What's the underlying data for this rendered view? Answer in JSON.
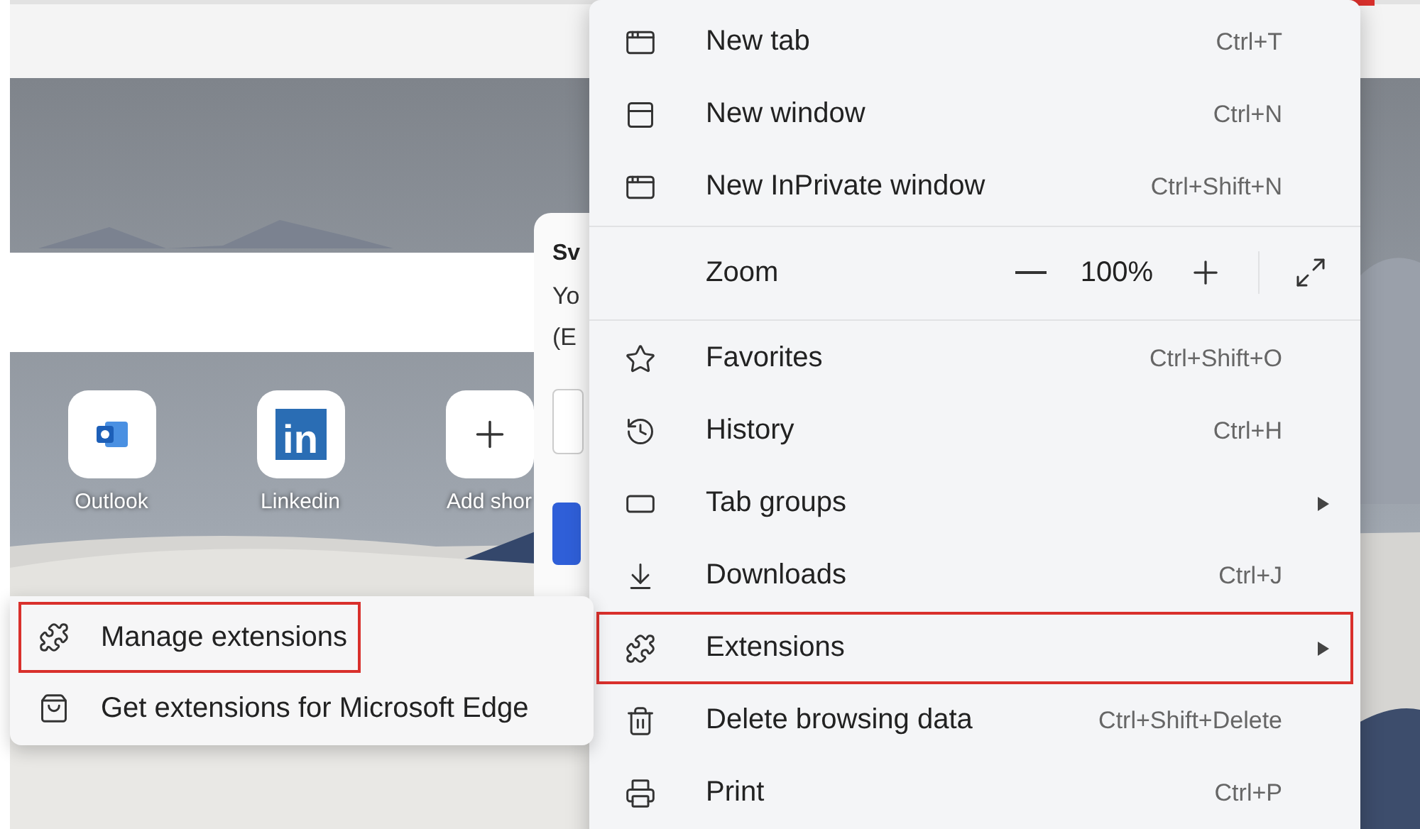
{
  "shortcuts": [
    {
      "kind": "outlook",
      "label": "Outlook"
    },
    {
      "kind": "logo_text",
      "logo_text": "in",
      "label": "Linkedin"
    },
    {
      "kind": "add",
      "label": "Add shor"
    }
  ],
  "side_card": {
    "title": "Sv",
    "lines": [
      "Yo",
      "(E"
    ]
  },
  "menu": {
    "items": [
      {
        "kind": "item",
        "label": "New tab",
        "shortcut": "Ctrl+T",
        "highlighted": false
      },
      {
        "kind": "item",
        "label": "New window",
        "shortcut": "Ctrl+N",
        "highlighted": false
      },
      {
        "kind": "item",
        "label": "New InPrivate window",
        "shortcut": "Ctrl+Shift+N",
        "highlighted": false
      },
      {
        "kind": "separator"
      },
      {
        "kind": "zoom",
        "label": "Zoom",
        "value": "100%"
      },
      {
        "kind": "separator"
      },
      {
        "kind": "item",
        "label": "Favorites",
        "shortcut": "Ctrl+Shift+O",
        "highlighted": false
      },
      {
        "kind": "item",
        "label": "History",
        "shortcut": "Ctrl+H",
        "highlighted": false
      },
      {
        "kind": "submenu",
        "label": "Tab groups",
        "highlighted": false
      },
      {
        "kind": "item",
        "label": "Downloads",
        "shortcut": "Ctrl+J",
        "highlighted": false
      },
      {
        "kind": "submenu",
        "label": "Extensions",
        "highlighted": true
      },
      {
        "kind": "item",
        "label": "Delete browsing data",
        "shortcut": "Ctrl+Shift+Delete",
        "highlighted": false
      },
      {
        "kind": "item",
        "label": "Print",
        "shortcut": "Ctrl+P",
        "highlighted": false
      }
    ]
  },
  "submenu": {
    "items": [
      {
        "label": "Manage extensions",
        "highlighted": true
      },
      {
        "label": "Get extensions for Microsoft Edge",
        "highlighted": false
      }
    ]
  }
}
